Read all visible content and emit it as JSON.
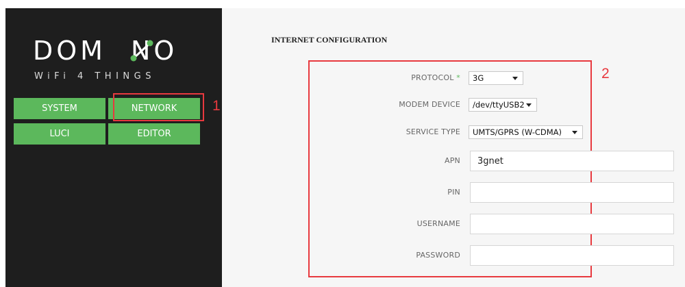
{
  "logo": {
    "text": "DOM∕NO",
    "tagline": "WiFi 4 THINGS"
  },
  "nav": {
    "system": "SYSTEM",
    "network": "NETWORK",
    "luci": "LUCI",
    "editor": "EDITOR"
  },
  "annotations": {
    "one": "1",
    "two": "2"
  },
  "section_title": "INTERNET CONFIGURATION",
  "form": {
    "protocol": {
      "label": "PROTOCOL",
      "required_mark": "*",
      "value": "3G"
    },
    "modem_device": {
      "label": "MODEM DEVICE",
      "value": "/dev/ttyUSB2"
    },
    "service_type": {
      "label": "SERVICE TYPE",
      "value": "UMTS/GPRS (W-CDMA)"
    },
    "apn": {
      "label": "APN",
      "value": "3gnet"
    },
    "pin": {
      "label": "PIN",
      "value": ""
    },
    "username": {
      "label": "USERNAME",
      "value": ""
    },
    "password": {
      "label": "PASSWORD",
      "value": ""
    }
  },
  "colors": {
    "accent_green": "#5cb85c",
    "sidebar_bg": "#1e1e1e",
    "highlight_red": "#e8393e"
  }
}
